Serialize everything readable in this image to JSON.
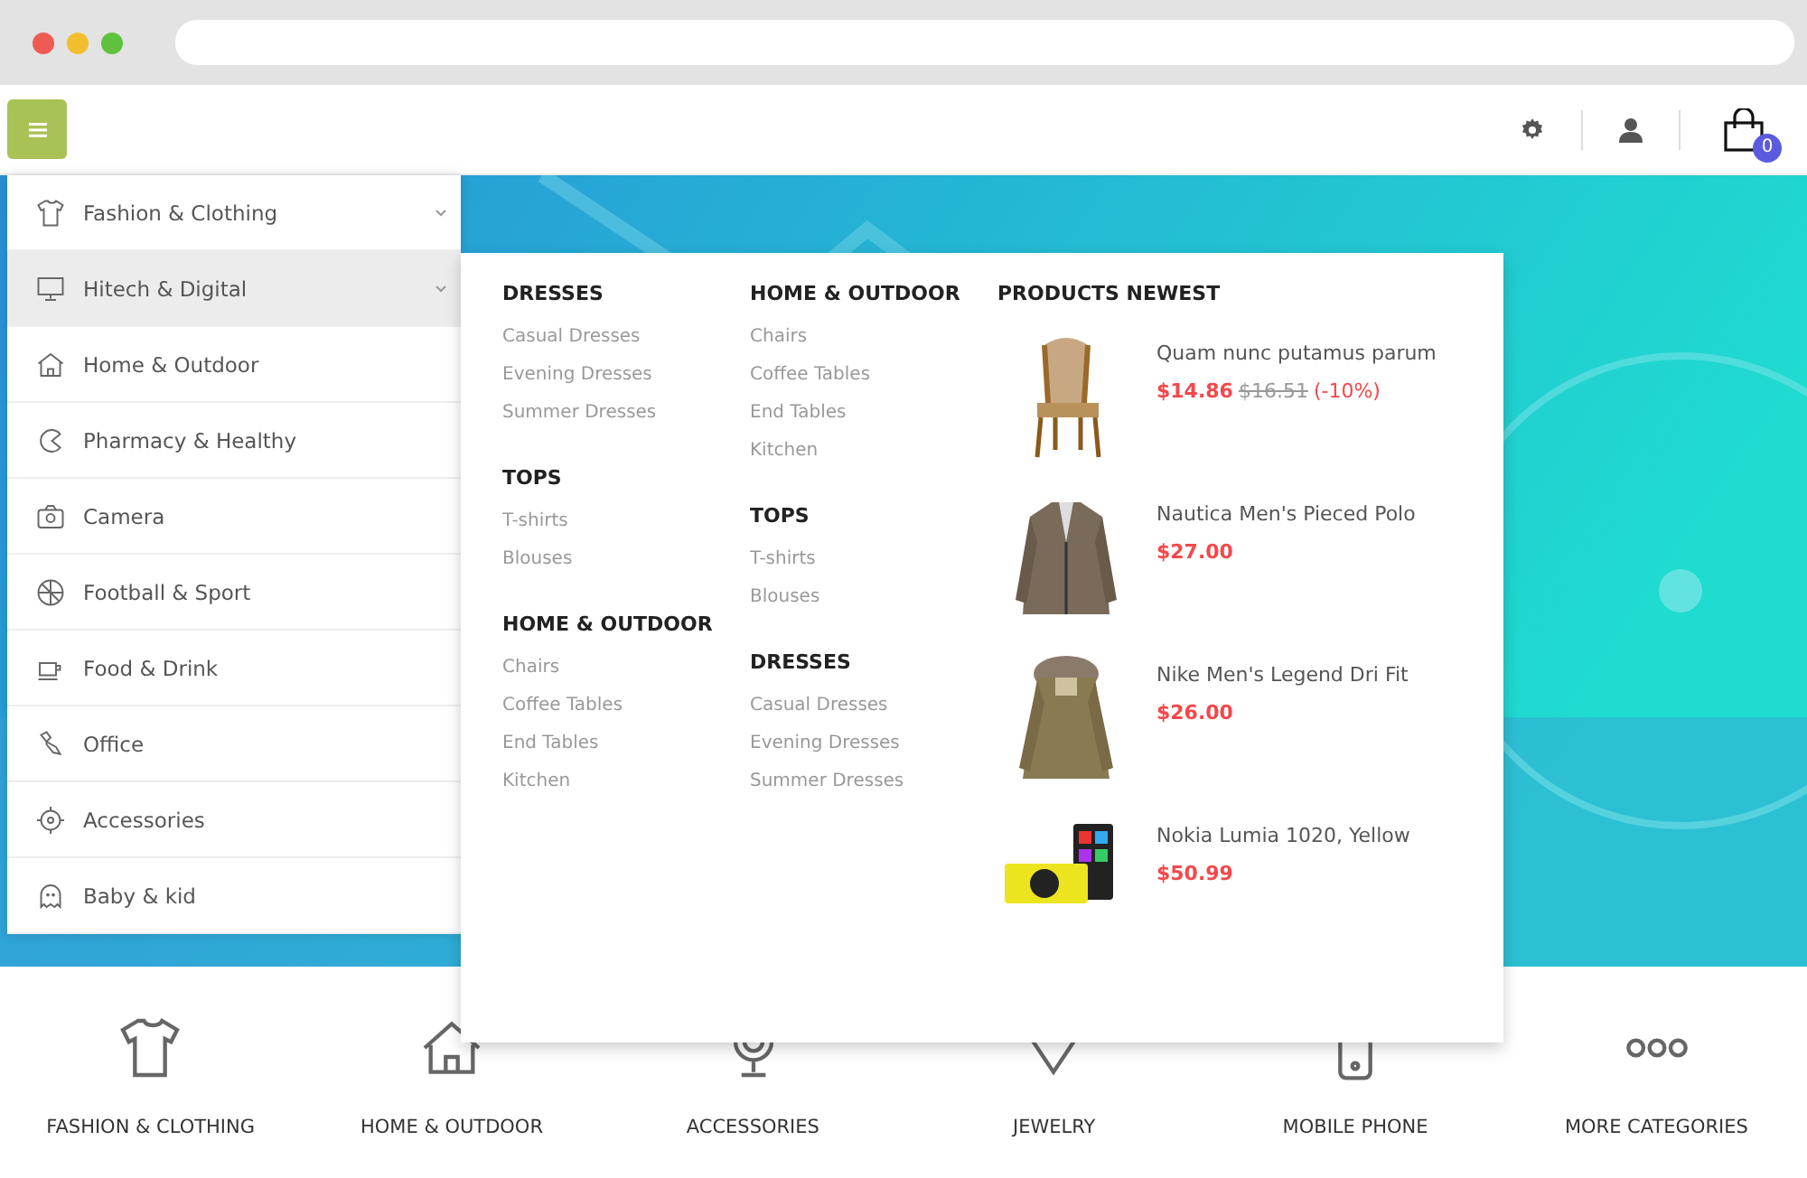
{
  "header": {
    "cart_count": "0"
  },
  "sidebar": {
    "items": [
      {
        "label": "Fashion & Clothing",
        "expandable": true,
        "selected": false
      },
      {
        "label": "Hitech & Digital",
        "expandable": true,
        "selected": true
      },
      {
        "label": "Home & Outdoor",
        "expandable": false,
        "selected": false
      },
      {
        "label": "Pharmacy & Healthy",
        "expandable": false,
        "selected": false
      },
      {
        "label": "Camera",
        "expandable": false,
        "selected": false
      },
      {
        "label": "Football & Sport",
        "expandable": false,
        "selected": false
      },
      {
        "label": "Food & Drink",
        "expandable": false,
        "selected": false
      },
      {
        "label": "Office",
        "expandable": false,
        "selected": false
      },
      {
        "label": "Accessories",
        "expandable": false,
        "selected": false
      },
      {
        "label": "Baby & kid",
        "expandable": false,
        "selected": false
      }
    ]
  },
  "mega_menu": {
    "columns": [
      [
        {
          "title": "DRESSES",
          "links": [
            "Casual Dresses",
            "Evening Dresses",
            "Summer Dresses"
          ]
        },
        {
          "title": "TOPS",
          "links": [
            "T-shirts",
            "Blouses"
          ]
        },
        {
          "title": "HOME & OUTDOOR",
          "links": [
            "Chairs",
            "Coffee Tables",
            "End Tables",
            "Kitchen"
          ]
        }
      ],
      [
        {
          "title": "HOME & OUTDOOR",
          "links": [
            "Chairs",
            "Coffee Tables",
            "End Tables",
            "Kitchen"
          ]
        },
        {
          "title": "TOPS",
          "links": [
            "T-shirts",
            "Blouses"
          ]
        },
        {
          "title": "DRESSES",
          "links": [
            "Casual Dresses",
            "Evening Dresses",
            "Summer Dresses"
          ]
        }
      ]
    ],
    "products": {
      "title": "PRODUCTS NEWEST",
      "items": [
        {
          "name": "Quam nunc putamus parum",
          "price": "$14.86",
          "old_price": "$16.51",
          "discount": "(-10%)"
        },
        {
          "name": "Nautica Men's Pieced Polo",
          "price": "$27.00"
        },
        {
          "name": "Nike Men's Legend Dri Fit",
          "price": "$26.00"
        },
        {
          "name": "Nokia Lumia 1020, Yellow",
          "price": "$50.99"
        }
      ]
    }
  },
  "categories": [
    {
      "label": "FASHION & CLOTHING"
    },
    {
      "label": "HOME & OUTDOOR"
    },
    {
      "label": "ACCESSORIES"
    },
    {
      "label": "JEWELRY"
    },
    {
      "label": "MOBILE PHONE"
    },
    {
      "label": "MORE CATEGORIES"
    }
  ]
}
